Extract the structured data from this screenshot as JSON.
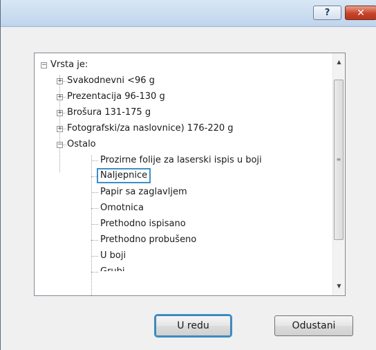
{
  "titlebar": {
    "help_glyph": "?",
    "close_glyph": "✕",
    "help_icon": "help-icon",
    "close_icon": "close-icon"
  },
  "tree": {
    "root": {
      "label": "Vrsta je:",
      "expanded": true
    },
    "children": [
      {
        "label": "Svakodnevni <96 g",
        "expanded": false
      },
      {
        "label": "Prezentacija 96-130 g",
        "expanded": false
      },
      {
        "label": "Brošura 131-175 g",
        "expanded": false
      },
      {
        "label": "Fotografski/za naslovnice) 176-220 g",
        "expanded": false
      },
      {
        "label": "Ostalo",
        "expanded": true,
        "children": [
          "Prozirne folije za laserski ispis u boji",
          "Naljepnice",
          "Papir sa zaglavljem",
          "Omotnica",
          "Prethodno ispisano",
          "Prethodno probušeno",
          "U boji",
          "Grubi"
        ]
      }
    ],
    "selected": "Naljepnice",
    "expander_expanded": "−",
    "expander_collapsed": "+"
  },
  "scrollbar": {
    "up_glyph": "▲",
    "down_glyph": "▼",
    "grip_glyph": "≡"
  },
  "buttons": {
    "ok_label": "U redu",
    "cancel_label": "Odustani"
  },
  "colors": {
    "selection_border": "#3b8fc7",
    "titlebar": "#c7d9ee",
    "close": "#c7432a"
  }
}
